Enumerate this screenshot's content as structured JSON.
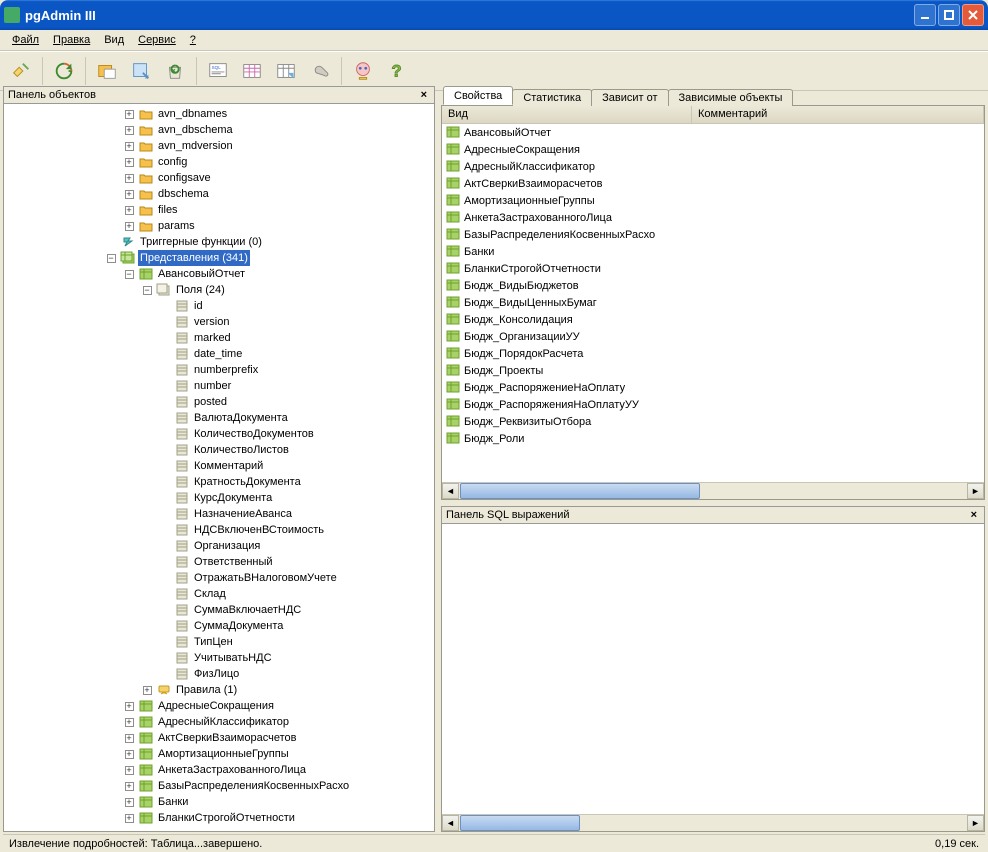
{
  "window": {
    "title": "pgAdmin III"
  },
  "menu": {
    "file": "Файл",
    "edit": "Правка",
    "view": "Вид",
    "service": "Сервис",
    "help": "?"
  },
  "panels": {
    "objects_title": "Панель объектов",
    "sql_title": "Панель SQL выражений"
  },
  "tabs": {
    "properties": "Свойства",
    "statistics": "Статистика",
    "depends": "Зависит от",
    "dependents": "Зависимые объекты"
  },
  "columns": {
    "view": "Вид",
    "comment": "Комментарий"
  },
  "status": {
    "left": "Извлечение подробностей: Таблица...завершено.",
    "right": "0,19 сек."
  },
  "tree": {
    "folders": [
      {
        "label": "avn_dbnames"
      },
      {
        "label": "avn_dbschema"
      },
      {
        "label": "avn_mdversion"
      },
      {
        "label": "config"
      },
      {
        "label": "configsave"
      },
      {
        "label": "dbschema"
      },
      {
        "label": "files"
      },
      {
        "label": "params"
      }
    ],
    "trigger_functions": "Триггерные функции (0)",
    "views_node": "Представления (341)",
    "first_view": "АвансовыйОтчет",
    "fields_node": "Поля (24)",
    "fields": [
      "id",
      "version",
      "marked",
      "date_time",
      "numberprefix",
      "number",
      "posted",
      "ВалютаДокумента",
      "КоличествоДокументов",
      "КоличествоЛистов",
      "Комментарий",
      "КратностьДокумента",
      "КурсДокумента",
      "НазначениеАванса",
      "НДСВключенВСтоимость",
      "Организация",
      "Ответственный",
      "ОтражатьВНалоговомУчете",
      "Склад",
      "СуммаВключаетНДС",
      "СуммаДокумента",
      "ТипЦен",
      "УчитыватьНДС",
      "ФизЛицо"
    ],
    "rules_node": "Правила (1)",
    "other_views": [
      "АдресныеСокращения",
      "АдресныйКлассификатор",
      "АктСверкиВзаиморасчетов",
      "АмортизационныеГруппы",
      "АнкетаЗастрахованногоЛица",
      "БазыРаспределенияКосвенныхРасхо",
      "Банки",
      "БланкиСтрогойОтчетности"
    ]
  },
  "views_list": [
    "АвансовыйОтчет",
    "АдресныеСокращения",
    "АдресныйКлассификатор",
    "АктСверкиВзаиморасчетов",
    "АмортизационныеГруппы",
    "АнкетаЗастрахованногоЛица",
    "БазыРаспределенияКосвенныхРасхо",
    "Банки",
    "БланкиСтрогойОтчетности",
    "Бюдж_ВидыБюджетов",
    "Бюдж_ВидыЦенныхБумаг",
    "Бюдж_Консолидация",
    "Бюдж_ОрганизацииУУ",
    "Бюдж_ПорядокРасчета",
    "Бюдж_Проекты",
    "Бюдж_РаспоряжениеНаОплату",
    "Бюдж_РаспоряженияНаОплатуУУ",
    "Бюдж_РеквизитыОтбора",
    "Бюдж_Роли"
  ]
}
